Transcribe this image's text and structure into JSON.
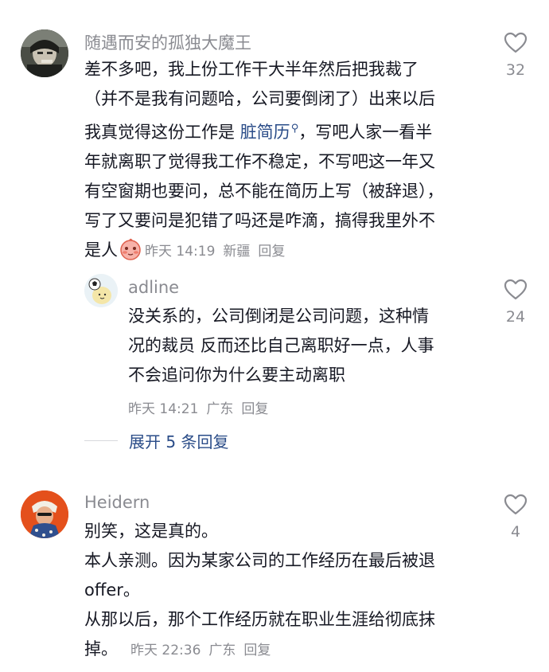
{
  "comments": [
    {
      "username": "随遇而安的孤独大魔王",
      "lines": [
        "差不多吧，我上份工作干大半年然后把我裁了",
        "（并不是我有问题哈，公司要倒闭了）出来以后",
        "我真觉得这份工作是",
        "年就离职了觉得我工作不稳定，不写吧这一年又",
        "有空窗期也要问，总不能在简历上写（被辞退），",
        "写了又要问是犯错了吗还是咋滴，搞得我里外不",
        "是人"
      ],
      "keyword": "脏简历",
      "line3_tail": "，写吧人家一看半",
      "time": "昨天 14:19",
      "location": "新疆",
      "reply": "回复",
      "likes": "32"
    },
    {
      "username": "adline",
      "lines": [
        "没关系的，公司倒闭是公司问题，这种情",
        "况的裁员 反而还比自己离职好一点，人事",
        "不会追问你为什么要主动离职"
      ],
      "time": "昨天 14:21",
      "location": "广东",
      "reply": "回复",
      "likes": "24"
    },
    {
      "username": "Heidern",
      "lines": [
        "别笑，这是真的。",
        "本人亲测。因为某家公司的工作经历在最后被退",
        "offer。",
        "从那以后，那个工作经历就在职业生涯给彻底抹",
        "掉。"
      ],
      "time": "昨天 22:36",
      "location": "广东",
      "reply": "回复",
      "likes": "4"
    }
  ],
  "expand_label": "展开 5 条回复",
  "icons": {
    "like": "heart-outline-icon",
    "search_hint": "search-icon",
    "emoji": "shy-face-emoji-icon"
  },
  "colors": {
    "text": "#161823",
    "secondary": "#8a8b91",
    "link": "#2a4c88"
  }
}
